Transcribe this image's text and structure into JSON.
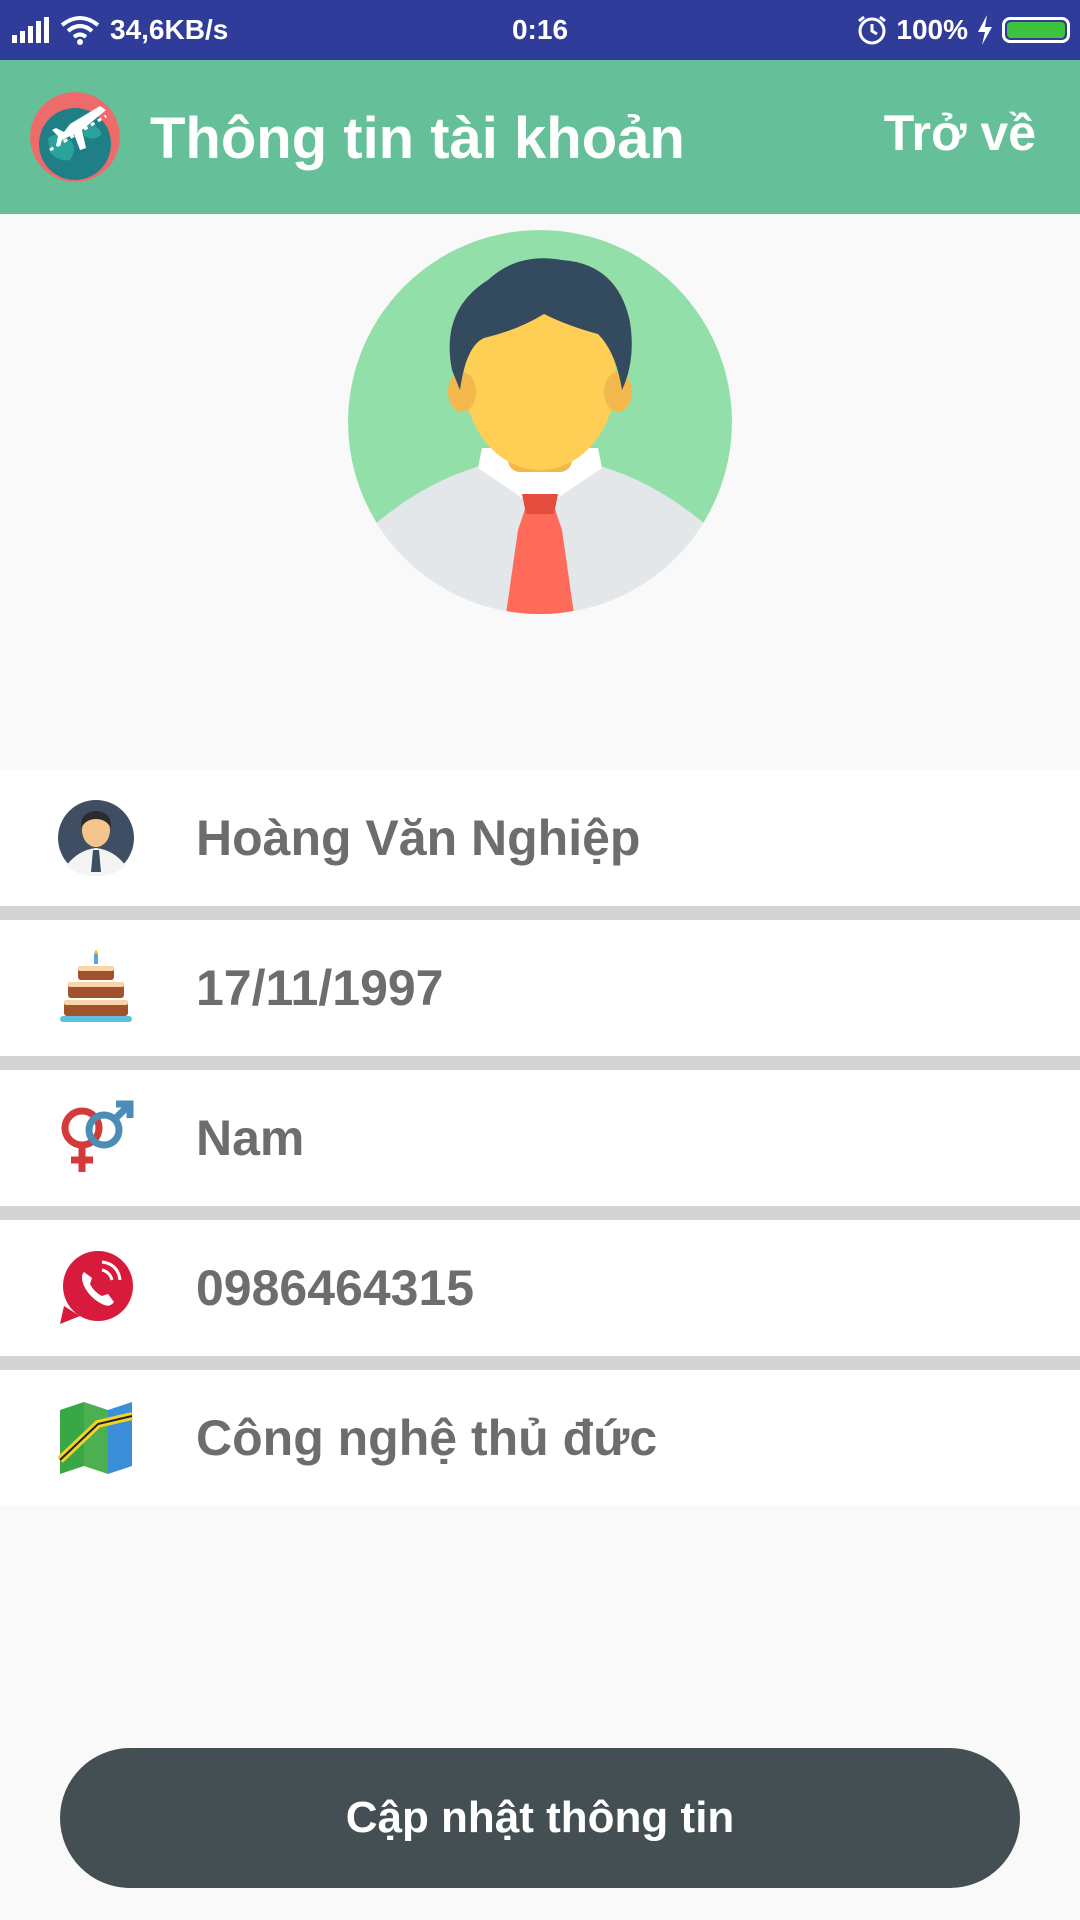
{
  "status_bar": {
    "network_speed": "34,6KB/s",
    "time": "0:16",
    "battery_percent": "100%"
  },
  "app_bar": {
    "title": "Thông tin tài khoản",
    "back_label": "Trở về"
  },
  "profile": {
    "full_name": "Hoàng Văn Nghiệp",
    "birthday": "17/11/1997",
    "gender": "Nam",
    "phone": "0986464315",
    "address": "Công nghệ thủ đức"
  },
  "actions": {
    "update_label": "Cập nhật thông tin"
  },
  "icons": {
    "app_logo": "globe-airplane-icon",
    "name": "user-icon",
    "birthday": "cake-icon",
    "gender": "gender-icon",
    "phone": "phone-icon",
    "address": "map-icon"
  },
  "colors": {
    "status_bar": "#2f3c9a",
    "app_bar": "#65bf99",
    "button": "#434f52",
    "avatar_bg": "#93dfa9"
  }
}
